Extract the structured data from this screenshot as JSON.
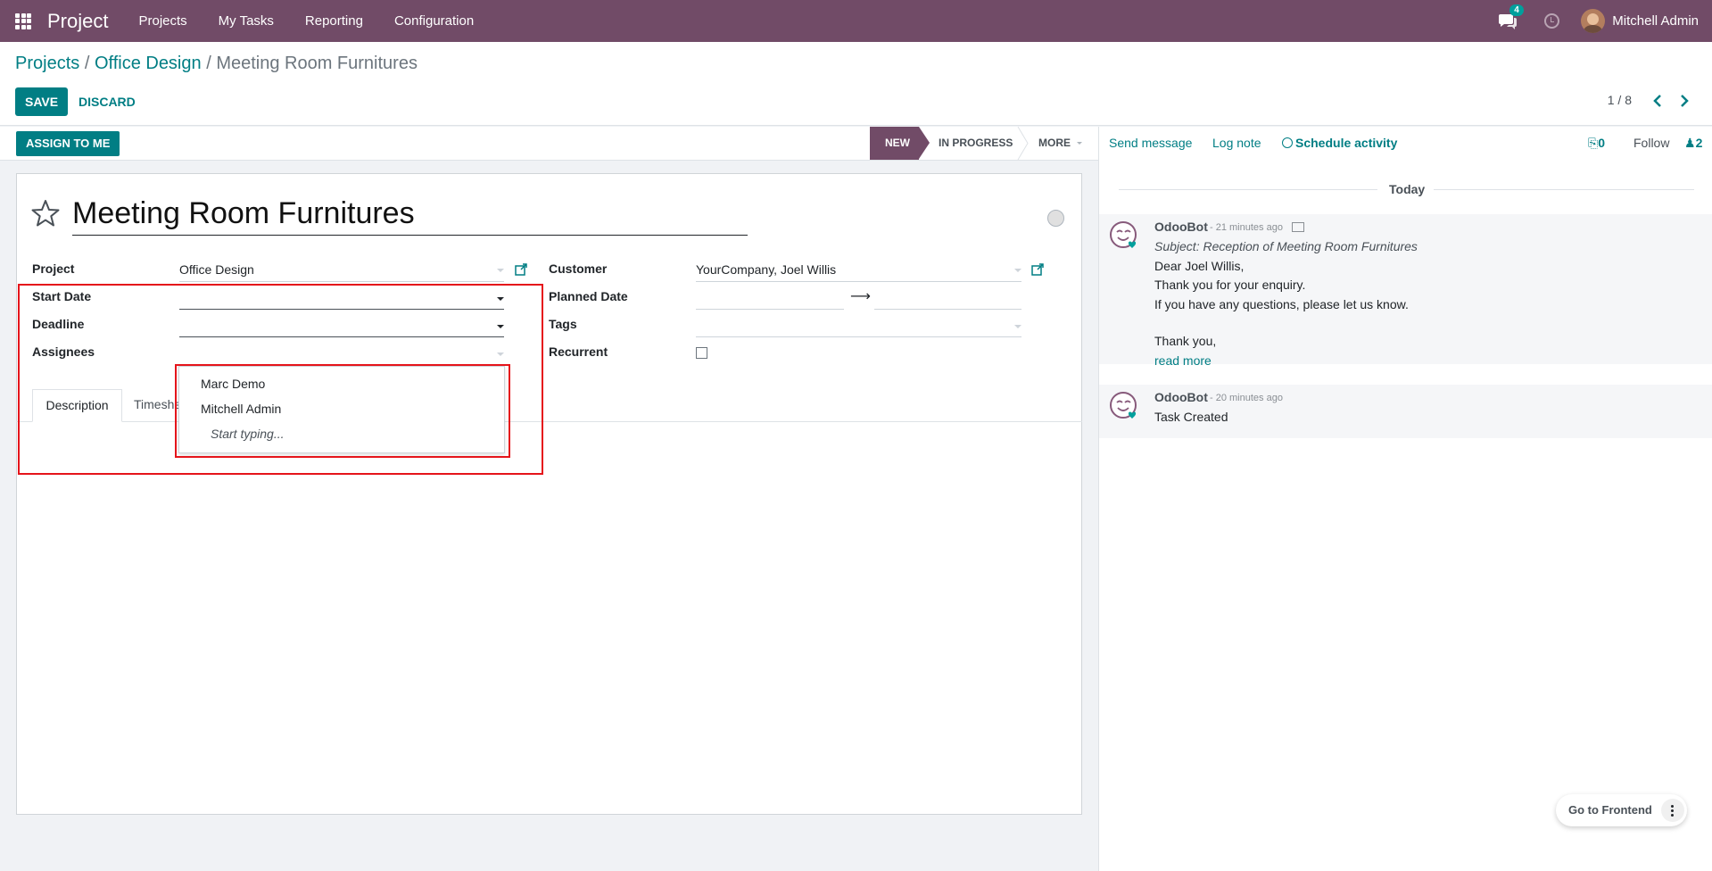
{
  "navbar": {
    "brand": "Project",
    "menu": [
      "Projects",
      "My Tasks",
      "Reporting",
      "Configuration"
    ],
    "chat_count": "4",
    "user_name": "Mitchell Admin"
  },
  "breadcrumb": {
    "items": [
      "Projects",
      "Office Design"
    ],
    "current": "Meeting Room Furnitures",
    "separator": "/"
  },
  "toolbar": {
    "save_label": "SAVE",
    "discard_label": "DISCARD",
    "pager": "1 / 8"
  },
  "statusbar": {
    "assign_label": "ASSIGN TO ME",
    "stages": [
      "NEW",
      "IN PROGRESS"
    ],
    "more_label": "MORE",
    "active_stage": "NEW"
  },
  "form": {
    "title": "Meeting Room Furnitures",
    "left_fields": [
      {
        "label": "Project",
        "value": "Office Design"
      },
      {
        "label": "Start Date",
        "value": ""
      },
      {
        "label": "Deadline",
        "value": ""
      },
      {
        "label": "Assignees",
        "value": ""
      }
    ],
    "right_fields": [
      {
        "label": "Customer",
        "value": "YourCompany, Joel Willis"
      },
      {
        "label": "Planned Date",
        "value": ""
      },
      {
        "label": "Tags",
        "value": ""
      },
      {
        "label": "Recurrent",
        "value": false
      }
    ],
    "planned_arrow": "⟶",
    "tabs": [
      "Description",
      "Timeshe"
    ]
  },
  "assignee_dropdown": {
    "options": [
      "Marc Demo",
      "Mitchell Admin"
    ],
    "hint": "Start typing..."
  },
  "chatter": {
    "send_message": "Send message",
    "log_note": "Log note",
    "schedule_activity": "Schedule activity",
    "attachments_count": "0",
    "follow_label": "Follow",
    "followers_count": "2",
    "date_separator": "Today",
    "messages": [
      {
        "author": "OdooBot",
        "time": "- 21 minutes ago",
        "subject": "Subject: Reception of Meeting Room Furnitures",
        "lines": [
          "Dear Joel Willis,",
          "Thank you for your enquiry.",
          "If you have any questions, please let us know.",
          "",
          "Thank you,"
        ],
        "read_more": "read more"
      },
      {
        "author": "OdooBot",
        "time": "- 20 minutes ago",
        "lines": [
          "Task Created"
        ]
      }
    ]
  },
  "frontend_button": "Go to Frontend",
  "colors": {
    "brand": "#714b67",
    "accent": "#017e84",
    "highlight": "#e5141b"
  }
}
